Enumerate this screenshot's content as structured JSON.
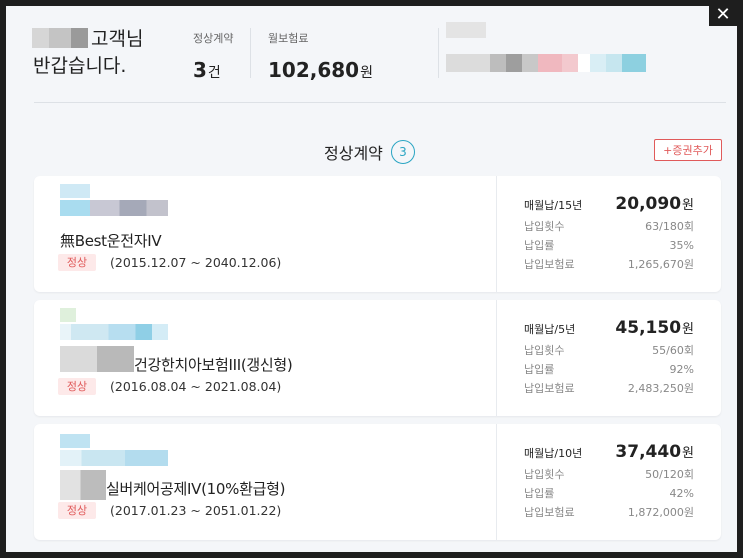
{
  "window": {
    "close_glyph": "✕"
  },
  "greeting": {
    "line1": "고객님",
    "line2": "반갑습니다."
  },
  "summary": {
    "contracts_label": "정상계약",
    "contracts_value": "3",
    "contracts_unit": "건",
    "premium_label": "월보험료",
    "premium_value": "102,680",
    "premium_unit": "원"
  },
  "section": {
    "title": "정상계약",
    "count": "3",
    "add_button": "+증권추가"
  },
  "cards": [
    {
      "name": "無Best운전자IV",
      "status": "정상",
      "period": "(2015.12.07 ~ 2040.12.06)",
      "pay_label": "매월납/15년",
      "pay_amount": "20,090",
      "pay_unit": "원",
      "count_label": "납입횟수",
      "count_value": "63/180회",
      "rate_label": "납입률",
      "rate_value": "35%",
      "paid_label": "납입보험료",
      "paid_value": "1,265,670원"
    },
    {
      "name": "건강한치아보험III(갱신형)",
      "status": "정상",
      "period": "(2016.08.04 ~ 2021.08.04)",
      "pay_label": "매월납/5년",
      "pay_amount": "45,150",
      "pay_unit": "원",
      "count_label": "납입횟수",
      "count_value": "55/60회",
      "rate_label": "납입률",
      "rate_value": "92%",
      "paid_label": "납입보험료",
      "paid_value": "2,483,250원"
    },
    {
      "name": "실버케어공제IV(10%환급형)",
      "status": "정상",
      "period": "(2017.01.23 ~ 2051.01.22)",
      "pay_label": "매월납/10년",
      "pay_amount": "37,440",
      "pay_unit": "원",
      "count_label": "납입횟수",
      "count_value": "50/120회",
      "rate_label": "납입률",
      "rate_value": "42%",
      "paid_label": "납입보험료",
      "paid_value": "1,872,000원"
    }
  ],
  "colors": {
    "accent": "#2aa5c3",
    "danger": "#e05a5a",
    "background": "#f4f6f9"
  }
}
